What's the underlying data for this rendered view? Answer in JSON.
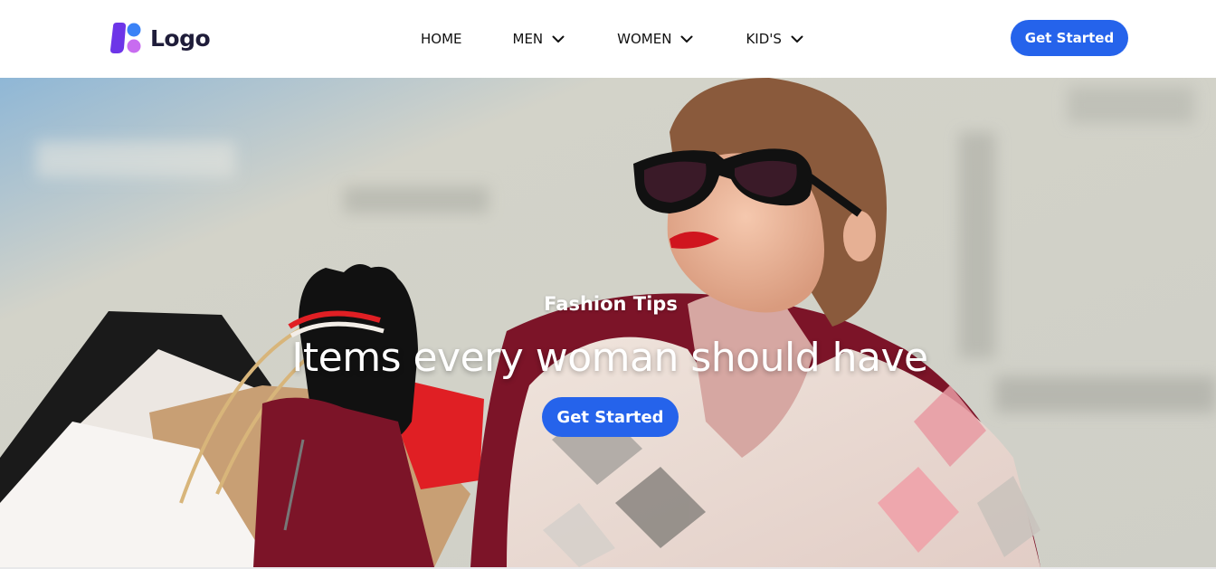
{
  "header": {
    "logo_text": "Logo",
    "nav": [
      {
        "label": "HOME",
        "has_dropdown": false
      },
      {
        "label": "MEN",
        "has_dropdown": true
      },
      {
        "label": "WOMEN",
        "has_dropdown": true
      },
      {
        "label": "KID'S",
        "has_dropdown": true
      }
    ],
    "cta_label": "Get Started"
  },
  "hero": {
    "eyebrow": "Fashion Tips",
    "title": "Items every woman should have",
    "cta_label": "Get Started"
  },
  "colors": {
    "accent": "#2563eb",
    "logo_text": "#1f1d3a",
    "logo_mark_primary": "#6d35e8",
    "logo_mark_blue": "#3b82f6",
    "logo_mark_pink": "#c86cf0"
  },
  "icons": {
    "logo": "logo-mark-icon",
    "dropdown": "chevron-down-icon"
  }
}
